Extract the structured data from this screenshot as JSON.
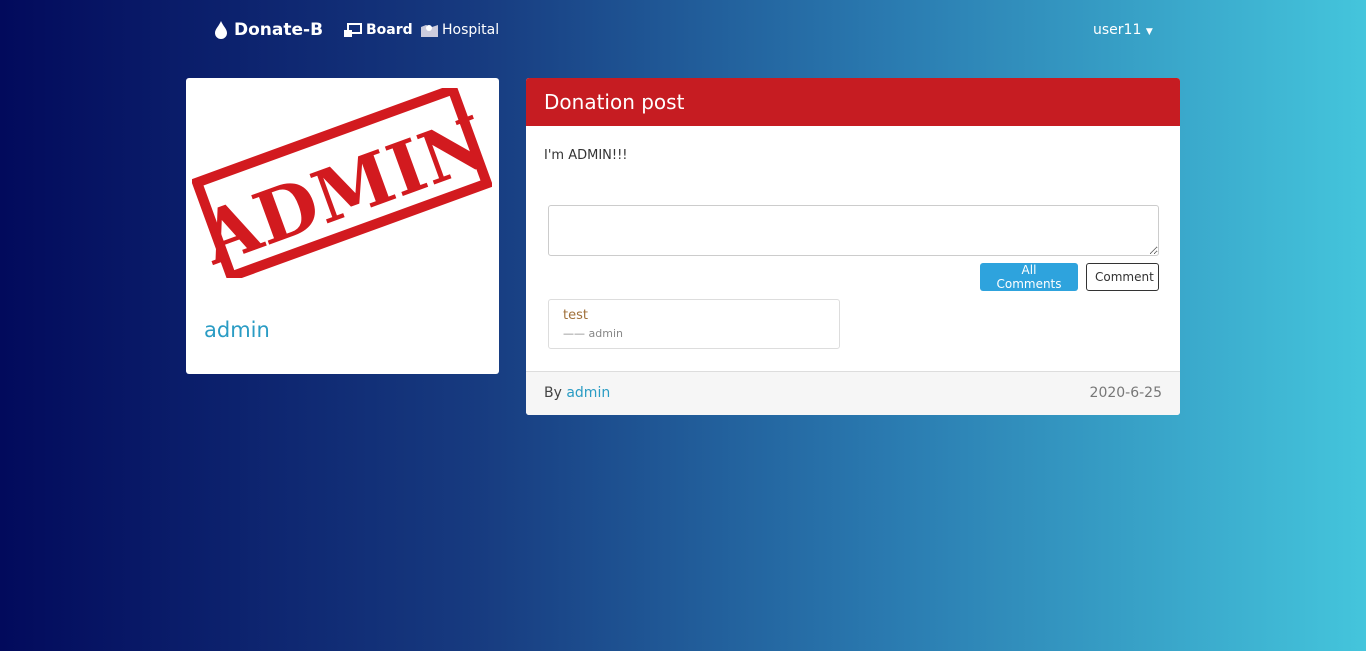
{
  "nav": {
    "brand": "Donate-B",
    "links": [
      {
        "label": "Board",
        "icon": "board-icon"
      },
      {
        "label": "Hospital",
        "icon": "hospital-icon"
      }
    ],
    "user": "user11"
  },
  "profile": {
    "image_text": "ADMIN",
    "name": "admin"
  },
  "post": {
    "title": "Donation post",
    "body": "I'm ADMIN!!!",
    "comment_value": "",
    "all_comments_label": "All Comments",
    "comment_label": "Comment",
    "comments": [
      {
        "text": "test",
        "author": "admin"
      }
    ],
    "footer": {
      "by_label": "By",
      "author": "admin",
      "date": "2020-6-25"
    }
  },
  "colors": {
    "header": "#c61c22",
    "accent": "#2a9cc4",
    "button": "#2ea3dd"
  }
}
